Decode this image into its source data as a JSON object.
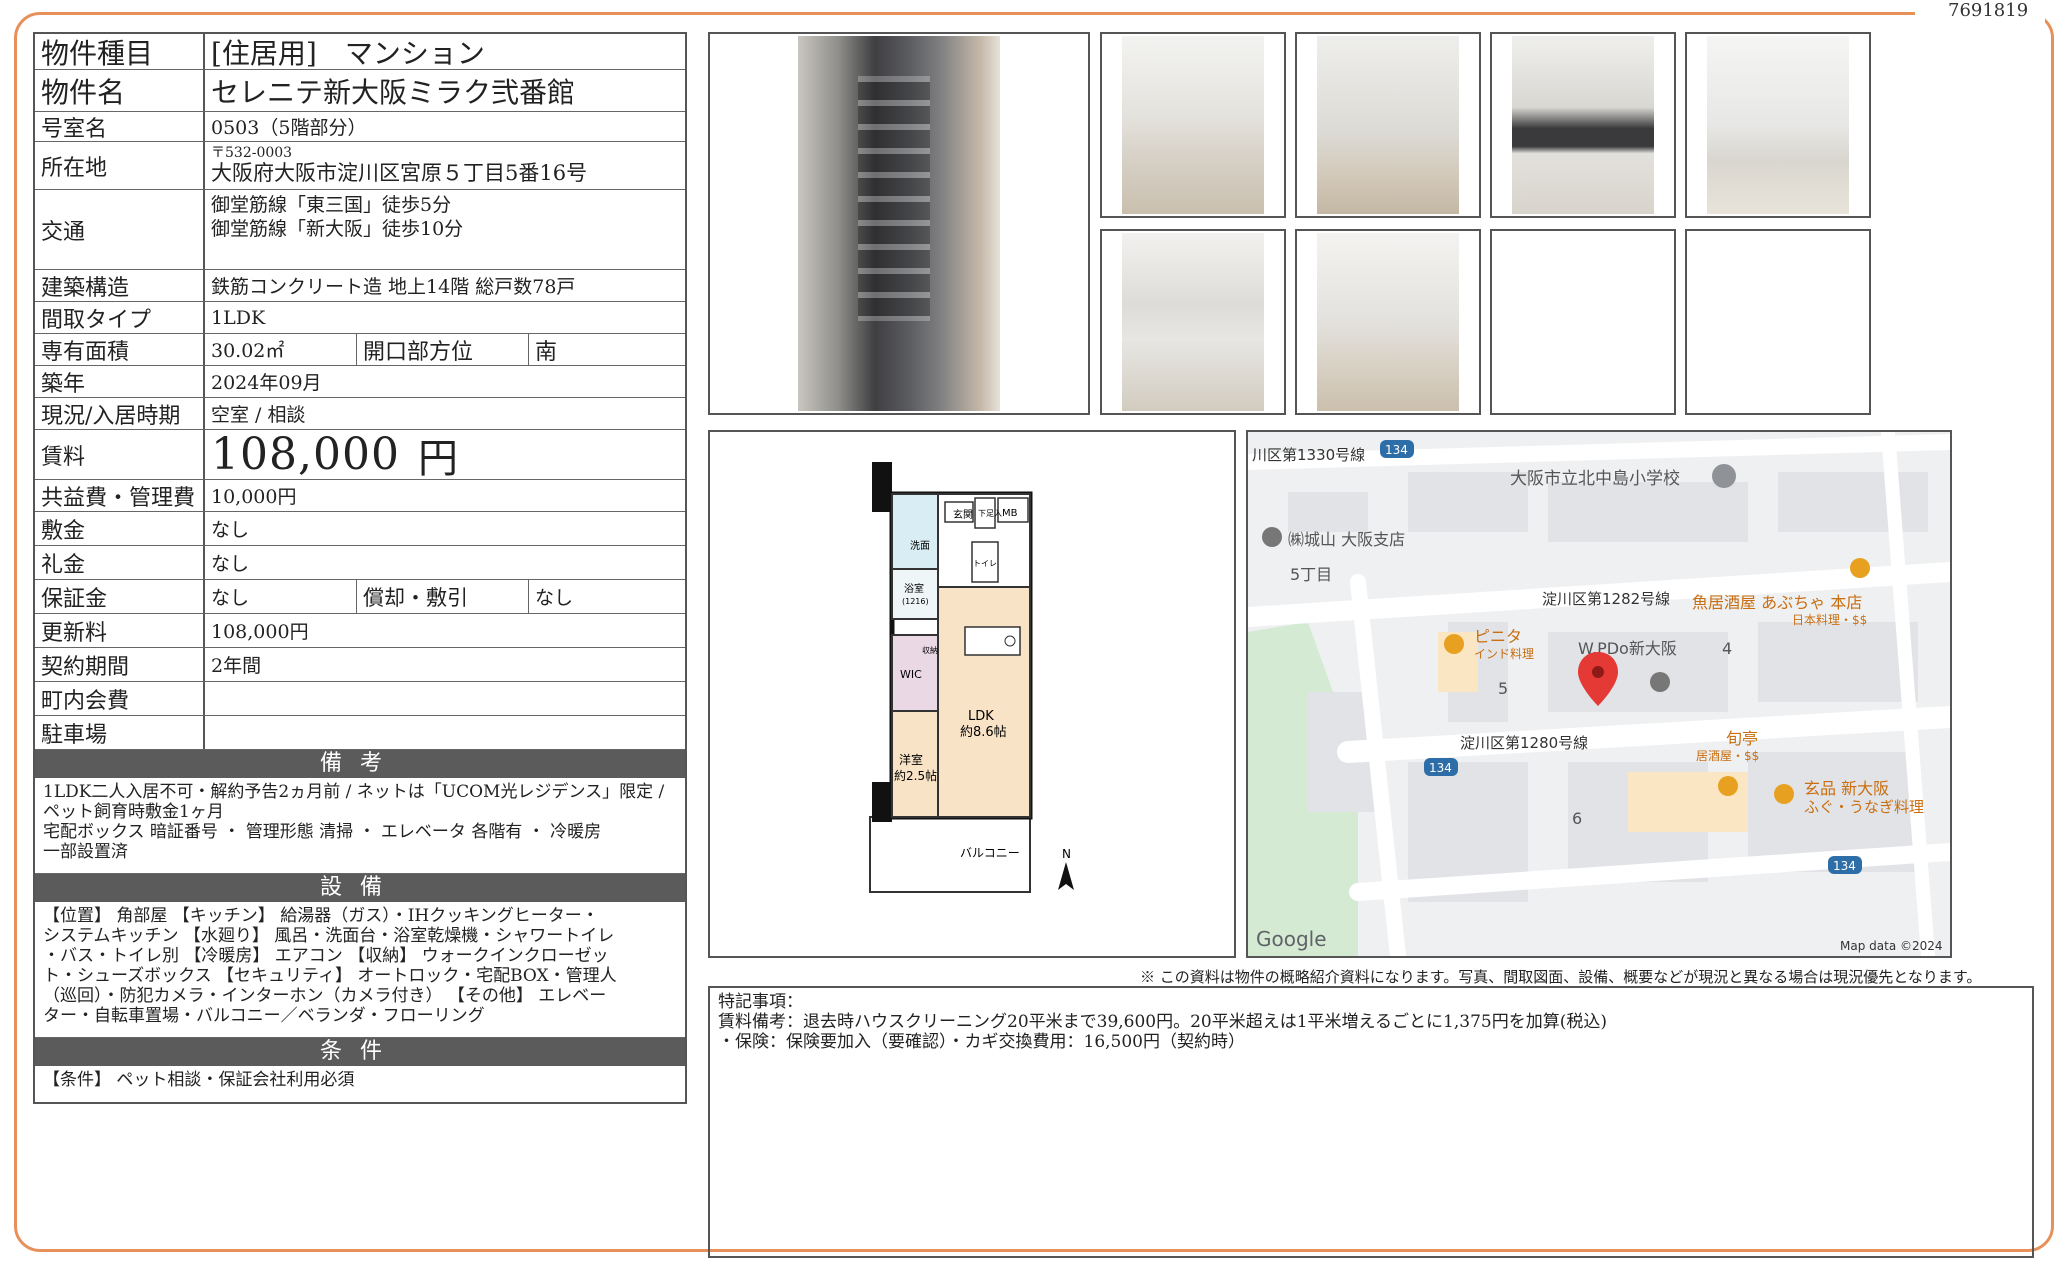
{
  "doc_id": "7691819",
  "property": {
    "type_label": "物件種目",
    "type_value": "[住居用]　マンション",
    "name_label": "物件名",
    "name_value": "セレニテ新大阪ミラク弐番館",
    "room_label": "号室名",
    "room_value": "0503（5階部分）",
    "address_label": "所在地",
    "address_zip": "〒532-0003",
    "address_value": "大阪府大阪市淀川区宮原５丁目5番16号",
    "access_label": "交通",
    "access_1": "御堂筋線「東三国」徒歩5分",
    "access_2": "御堂筋線「新大阪」徒歩10分",
    "structure_label": "建築構造",
    "structure_value": "鉄筋コンクリート造 地上14階 総戸数78戸",
    "layout_label": "間取タイプ",
    "layout_value": "1LDK",
    "area_label": "専有面積",
    "area_value": "30.02㎡",
    "direction_label": "開口部方位",
    "direction_value": "南",
    "built_label": "築年",
    "built_value": "2024年09月",
    "status_label": "現況/入居時期",
    "status_value": "空室 /  相談",
    "rent_label": "賃料",
    "rent_value": "108,000",
    "rent_unit": "円",
    "fee_label": "共益費・管理費",
    "fee_value": "10,000円",
    "deposit_label": "敷金",
    "deposit_value": "なし",
    "key_money_label": "礼金",
    "key_money_value": "なし",
    "guarantee_label": "保証金",
    "guarantee_value": "なし",
    "amort_label": "償却・敷引",
    "amort_value": "なし",
    "renewal_label": "更新料",
    "renewal_value": "108,000円",
    "contract_label": "契約期間",
    "contract_value": "2年間",
    "community_label": "町内会費",
    "community_value": "",
    "parking_label": "駐車場",
    "parking_value": ""
  },
  "remarks": {
    "title": "備考",
    "lines": [
      "1LDK二人入居不可・解約予告2ヵ月前 /  ネットは「UCOM光レジデンス」限定 /",
      "ペット飼育時敷金1ヶ月",
      "宅配ボックス 暗証番号 ・ 管理形態 清掃 ・ エレベータ 各階有 ・ 冷暖房",
      "一部設置済"
    ]
  },
  "equipment": {
    "title": "設備",
    "lines": [
      "【位置】 角部屋 【キッチン】 給湯器（ガス）・IHクッキングヒーター・",
      "システムキッチン 【水廻り】 風呂・洗面台・浴室乾燥機・シャワートイレ",
      "・バス・トイレ別 【冷暖房】 エアコン 【収納】 ウォークインクローゼッ",
      "ト・シューズボックス 【セキュリティ】 オートロック・宅配BOX・管理人",
      "（巡回）・防犯カメラ・インターホン（カメラ付き） 【その他】 エレベー",
      "ター・自転車置場・バルコニー／ベランダ・フローリング"
    ]
  },
  "conditions": {
    "title": "条件",
    "lines": [
      "【条件】 ペット相談・保証会社利用必須"
    ]
  },
  "floorplan": {
    "genkan": "玄関",
    "mb": "MB",
    "shoes": "下足入",
    "wash": "洗面",
    "bath": "浴室",
    "bath_size": "(1216)",
    "toilet": "トイレ",
    "storage": "収納",
    "wic": "WIC",
    "ldk": "LDK",
    "ldk_size": "約8.6帖",
    "western": "洋室",
    "western_size": "約2.5帖",
    "balcony": "バルコニー",
    "north": "N"
  },
  "map": {
    "road_1330": "川区第1330号線",
    "badge_134": "134",
    "school": "大阪市立北中島小学校",
    "shiroyama": "㈱城山 大阪支店",
    "chome5": "5丁目",
    "road_1282": "淀川区第1282号線",
    "abucha": "魚居酒屋 あぶちゃ 本店",
    "abucha_sub": "日本料理・$$",
    "pinita": "ピニタ",
    "pinita_sub": "インド料理",
    "property_label": "W.PDo新大阪",
    "block4": "4",
    "block5": "5",
    "road_1280": "淀川区第1280号線",
    "shuntei": "旬亭",
    "shuntei_sub": "居酒屋・$$",
    "genpin": "玄品 新大阪",
    "genpin_sub": "ふぐ・うなぎ料理",
    "block6": "6",
    "google": "Google",
    "copyright": "Map data ©2024"
  },
  "disclaimer": "※ この資料は物件の概略紹介資料になります。写真、間取図面、設備、概要などが現況と異なる場合は現況優先となります。",
  "notes": {
    "title": "特記事項：",
    "line1": "賃料備考：退去時ハウスクリーニング20平米まで39,600円。20平米超えは1平米増えるごとに1,375円を加算(税込)",
    "line2": "・保険：保険要加入（要確認）・カギ交換費用：16,500円（契約時）"
  }
}
